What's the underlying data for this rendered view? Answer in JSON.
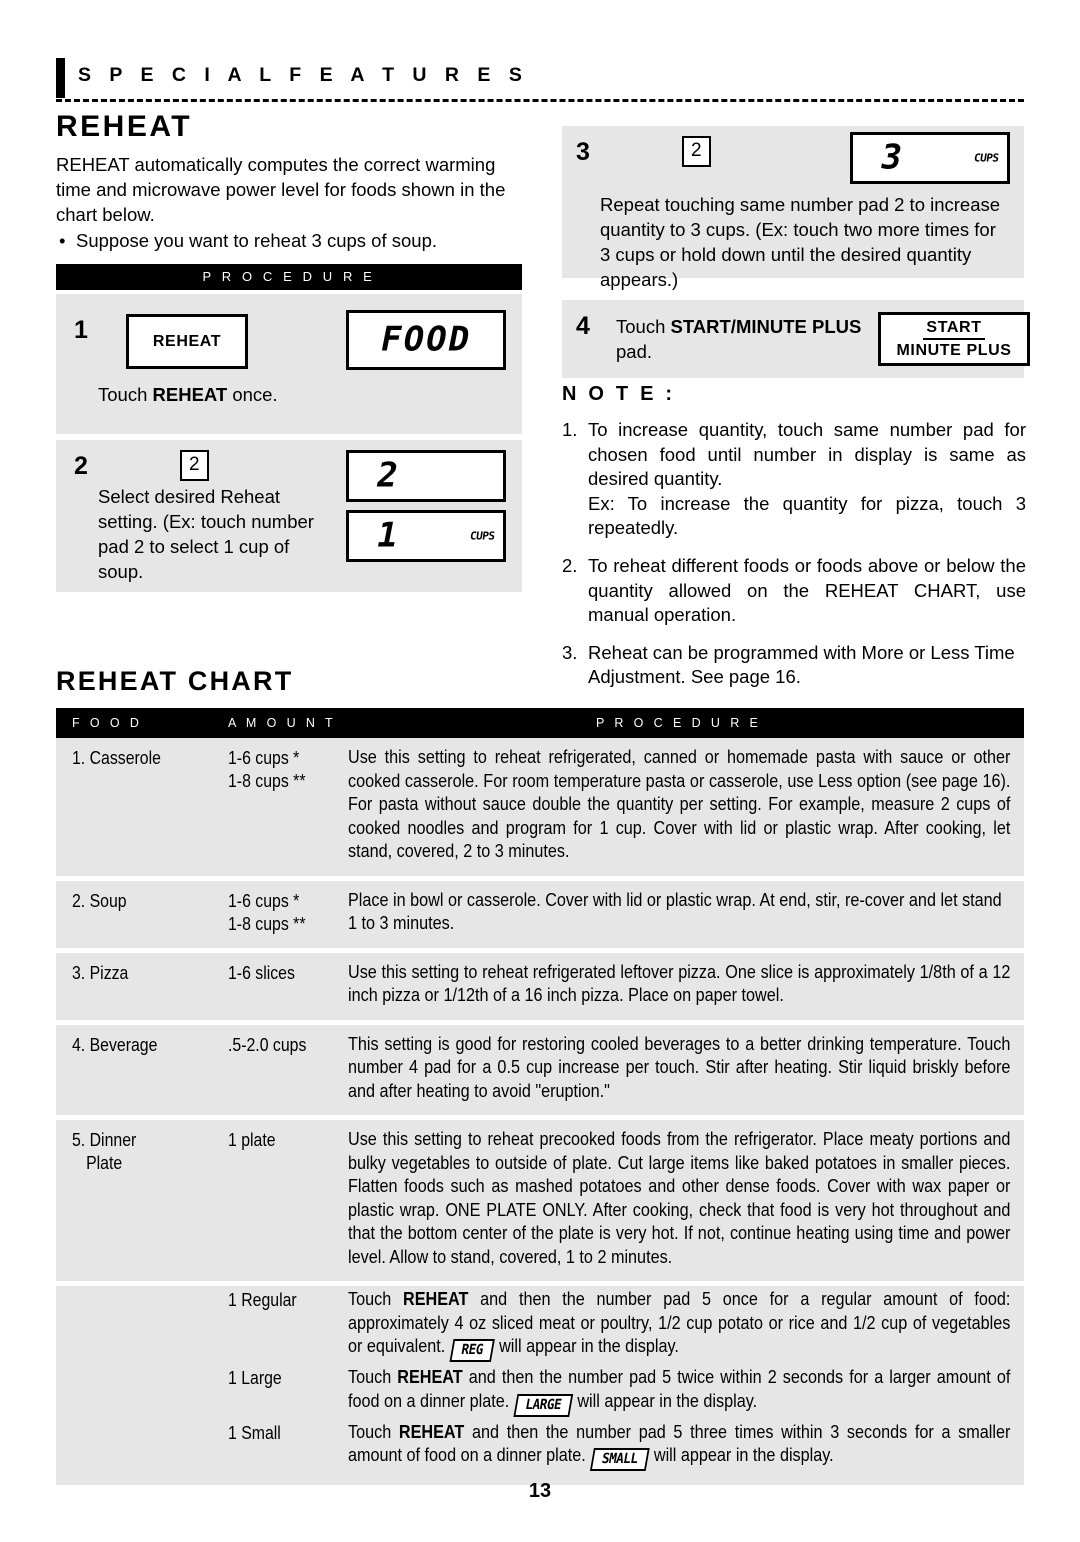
{
  "section": {
    "header": "S P E C I A L   F E A T U R E S"
  },
  "reheat": {
    "title": "REHEAT",
    "intro": "REHEAT automatically computes the correct warming time and microwave power level for foods shown in the chart below.",
    "bullet_dot": "•",
    "bullet": "Suppose you want to reheat 3 cups of soup.",
    "procedure_header": "P R O C E D U R E"
  },
  "steps": [
    {
      "num": "1",
      "pad_label": "REHEAT",
      "display": "FOOD",
      "text_prefix": "Touch ",
      "text_bold": "REHEAT",
      "text_suffix": " once."
    },
    {
      "num": "2",
      "key": "2",
      "display_1": "2",
      "display_2": "1",
      "display_2_unit": "CUPS",
      "text": "Select desired Reheat setting. (Ex: touch number pad 2  to select 1 cup of soup."
    },
    {
      "num": "3",
      "key": "2",
      "display": "3",
      "display_unit": "CUPS",
      "text": "Repeat touching same number pad 2  to increase quantity to 3 cups. (Ex: touch two more times for 3 cups or hold down until the desired quantity appears.)"
    },
    {
      "num": "4",
      "text_prefix": "Touch ",
      "text_bold1": "START/MINUTE",
      "text_mid": " ",
      "text_bold2": "PLUS",
      "text_suffix": " pad.",
      "pad_line1": "START",
      "pad_line2": "MINUTE PLUS"
    }
  ],
  "note": {
    "title": "N O T E :",
    "items": [
      {
        "n": "1.",
        "p1": "To increase quantity, touch same number pad for chosen food until number in display is same as desired quantity.",
        "p2": "Ex: To increase the quantity for pizza, touch 3 repeatedly."
      },
      {
        "n": "2.",
        "p1": "To reheat different foods or foods above or below the quantity allowed on the REHEAT CHART, use manual operation."
      },
      {
        "n": "3.",
        "p1": "Reheat can be programmed with More or Less Time Adjustment. See page 16."
      }
    ]
  },
  "chart": {
    "title": "REHEAT CHART",
    "columns": {
      "food": "F O O D",
      "amount": "A M O U N T",
      "procedure": "P R O C E D U R E"
    },
    "rows": [
      {
        "food": "1. Casserole",
        "amount_line1": "1-6 cups *",
        "amount_line2": "1-8 cups **",
        "procedure": "Use this setting to reheat refrigerated, canned or homemade pasta with sauce or other cooked casserole. For room temperature pasta or casserole, use Less option (see page 16). For pasta without sauce double the quantity per setting. For example, measure 2 cups of cooked noodles and program for 1 cup. Cover with lid or plastic wrap. After cooking, let stand, covered, 2 to 3 minutes."
      },
      {
        "food": "2. Soup",
        "amount_line1": "1-6 cups *",
        "amount_line2": "1-8 cups **",
        "procedure": "Place in bowl or casserole. Cover with lid or plastic wrap. At end, stir, re-cover and let stand 1 to 3 minutes."
      },
      {
        "food": "3. Pizza",
        "amount_line1": "1-6 slices",
        "procedure": "Use this setting to reheat refrigerated leftover pizza. One slice is approximately 1/8th  of a 12 inch pizza or 1/12th of a 16 inch pizza. Place on paper towel."
      },
      {
        "food": "4. Beverage",
        "amount_line1": ".5-2.0 cups",
        "procedure": "This setting is good for restoring cooled beverages to a better drinking temperature. Touch number 4  pad for a 0.5 cup increase per touch. Stir after heating. Stir liquid briskly before and after heating to avoid \"eruption.\""
      }
    ],
    "dinner_plate": {
      "food_line1": "5. Dinner",
      "food_line2": "Plate",
      "amount": "1 plate",
      "procedure": "Use this setting to reheat precooked foods from the refrigerator. Place meaty portions and bulky vegetables to outside of plate. Cut large items like baked potatoes in smaller pieces. Flatten foods such as mashed potatoes and other dense foods. Cover with wax paper or plastic wrap. ONE PLATE ONLY. After cooking, check that food is very hot throughout and that the bottom center of the plate is very hot. If not, continue heating using time and power level. Allow to stand, covered, 1 to 2 minutes.",
      "sub_rows": [
        {
          "amount": "1 Regular",
          "t1": "Touch ",
          "b1": "REHEAT",
          "t2": " and then the number pad  5   once for a regular amount of food: approximately 4 oz sliced meat or poultry, 1/2 cup potato or rice and 1/2 cup of vegetables or equivalent. ",
          "chip": "REG",
          "t3": " will appear in the display."
        },
        {
          "amount": "1 Large",
          "t1": "Touch ",
          "b1": "REHEAT",
          "t2": " and then the number pad 5   twice within 2 seconds for a larger amount of food on a dinner plate. ",
          "chip": "LARGE",
          "t3": " will appear in the display."
        },
        {
          "amount": "1 Small",
          "t1": "Touch ",
          "b1": "REHEAT",
          "t2": " and then the number pad  5   three times within 3 seconds for a smaller amount of food on a dinner plate. ",
          "chip": "SMALL",
          "t3": " will appear in the display."
        }
      ]
    }
  },
  "footer": {
    "page_number": "13"
  }
}
